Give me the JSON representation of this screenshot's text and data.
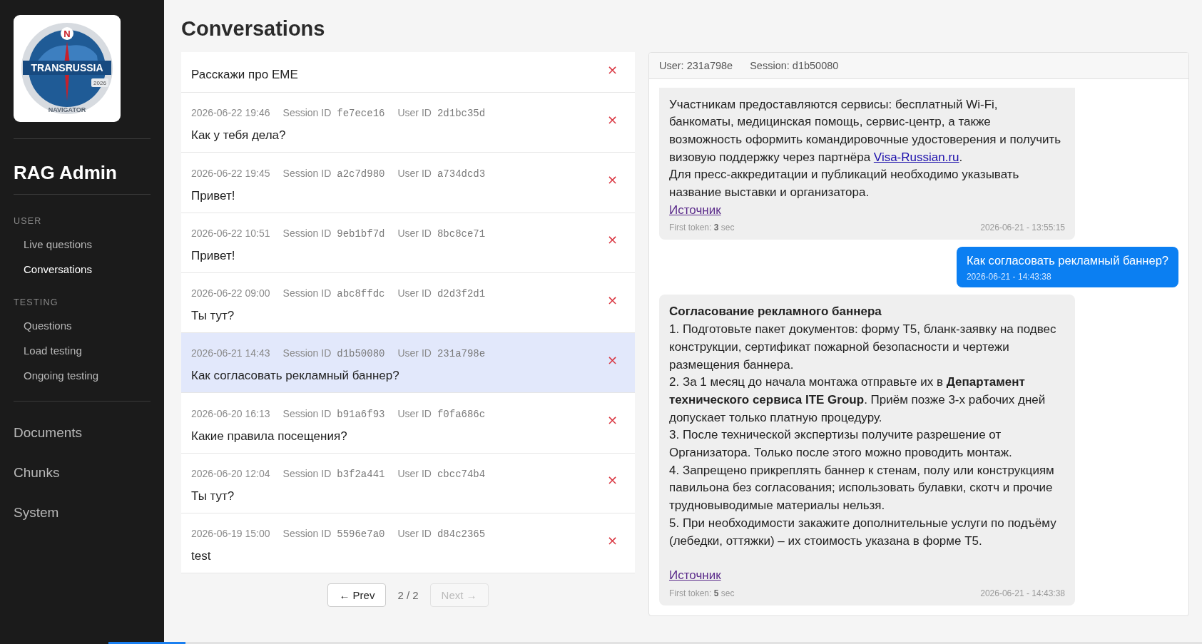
{
  "sidebar": {
    "logo": {
      "mark": "N",
      "title": "TRANSRUSSIA",
      "year": "2026",
      "subtitle": "NAVIGATOR"
    },
    "brand": "RAG Admin",
    "sections": [
      {
        "label": "USER",
        "items": [
          {
            "label": "Live questions",
            "selected": false
          },
          {
            "label": "Conversations",
            "selected": true
          }
        ]
      },
      {
        "label": "TESTING",
        "items": [
          {
            "label": "Questions",
            "selected": false
          },
          {
            "label": "Load testing",
            "selected": false
          },
          {
            "label": "Ongoing testing",
            "selected": false
          }
        ]
      }
    ],
    "main_items": [
      {
        "label": "Documents",
        "selected": false
      },
      {
        "label": "Chunks",
        "selected": false
      },
      {
        "label": "System",
        "selected": false
      }
    ]
  },
  "page": {
    "title": "Conversations"
  },
  "conversations": {
    "delete": "×",
    "rows": [
      {
        "message": "Расскажи про EME",
        "selected": false
      },
      {
        "date": "2026-06-22 19:46",
        "session_label": "Session ID",
        "session": "fe7ece16",
        "user_label": "User ID",
        "user": "2d1bc35d",
        "message": "Как у тебя дела?",
        "selected": false
      },
      {
        "date": "2026-06-22 19:45",
        "session_label": "Session ID",
        "session": "a2c7d980",
        "user_label": "User ID",
        "user": "a734dcd3",
        "message": "Привет!",
        "selected": false
      },
      {
        "date": "2026-06-22 10:51",
        "session_label": "Session ID",
        "session": "9eb1bf7d",
        "user_label": "User ID",
        "user": "8bc8ce71",
        "message": "Привет!",
        "selected": false
      },
      {
        "date": "2026-06-22 09:00",
        "session_label": "Session ID",
        "session": "abc8ffdc",
        "user_label": "User ID",
        "user": "d2d3f2d1",
        "message": "Ты тут?",
        "selected": false
      },
      {
        "date": "2026-06-21 14:43",
        "session_label": "Session ID",
        "session": "d1b50080",
        "user_label": "User ID",
        "user": "231a798e",
        "message": "Как согласовать рекламный баннер?",
        "selected": true
      },
      {
        "date": "2026-06-20 16:13",
        "session_label": "Session ID",
        "session": "b91a6f93",
        "user_label": "User ID",
        "user": "f0fa686c",
        "message": "Какие правила посещения?",
        "selected": false
      },
      {
        "date": "2026-06-20 12:04",
        "session_label": "Session ID",
        "session": "b3f2a441",
        "user_label": "User ID",
        "user": "cbcc74b4",
        "message": "Ты тут?",
        "selected": false
      },
      {
        "date": "2026-06-19 15:00",
        "session_label": "Session ID",
        "session": "5596e7a0",
        "user_label": "User ID",
        "user": "d84c2365",
        "message": "test",
        "selected": false
      }
    ],
    "pager": {
      "prev": {
        "label": "← Prev",
        "disabled": false
      },
      "page": "2 / 2",
      "next": {
        "label": "Next →",
        "disabled": true
      }
    }
  },
  "chat": {
    "user": "User: 231a798e",
    "session": "Session: d1b50080",
    "messages": [
      {
        "kind": "assistant",
        "paragraphs": [
          {
            "text": "Участникам предоставляются сервисы: бесплатный Wi-Fi, банкоматы, медицинская помощь, сервис-центр, а также возможность оформить командировочные удостоверения и получить визовую поддержку через партнёра ",
            "link": "Visa-Russian.ru",
            "after": "."
          },
          {
            "text": "Для пресс-аккредитации и публикаций необходимо указывать название выставки и организатора."
          }
        ],
        "source": "Источник",
        "first_token": "First token: **3** sec",
        "time": "2026-06-21 - 13:55:15"
      },
      {
        "kind": "user",
        "text": "Как согласовать рекламный баннер?",
        "time": "2026-06-21 - 14:43:38"
      },
      {
        "kind": "assistant",
        "title": "Согласование рекламного баннера",
        "paragraphs": [
          {
            "text": "1. Подготовьте пакет документов: форму Т5, бланк-заявку на подвес конструкции, сертификат пожарной безопасности и чертежи размещения баннера."
          },
          {
            "text": "2. За 1 месяц до начала монтажа отправьте их в **Департамент технического сервиса ITE Group**. Приём позже 3-х рабочих дней допускает только платную процедуру."
          },
          {
            "text": "3. После технической экспертизы получите разрешение от Организатора. Только после этого можно проводить монтаж."
          },
          {
            "text": "4. Запрещено прикреплять баннер к стенам, полу или конструкциям павильона без согласования; использовать булавки, скотч и прочие трудновыводимые материалы нельзя."
          },
          {
            "text": "5. При необходимости закажите дополнительные услуги по подъёму (лебедки, оттяжки) – их стоимость указана в форме Т5."
          }
        ],
        "source": "Источник",
        "first_token": "First token: **5** sec",
        "time": "2026-06-21 - 14:43:38"
      }
    ]
  }
}
